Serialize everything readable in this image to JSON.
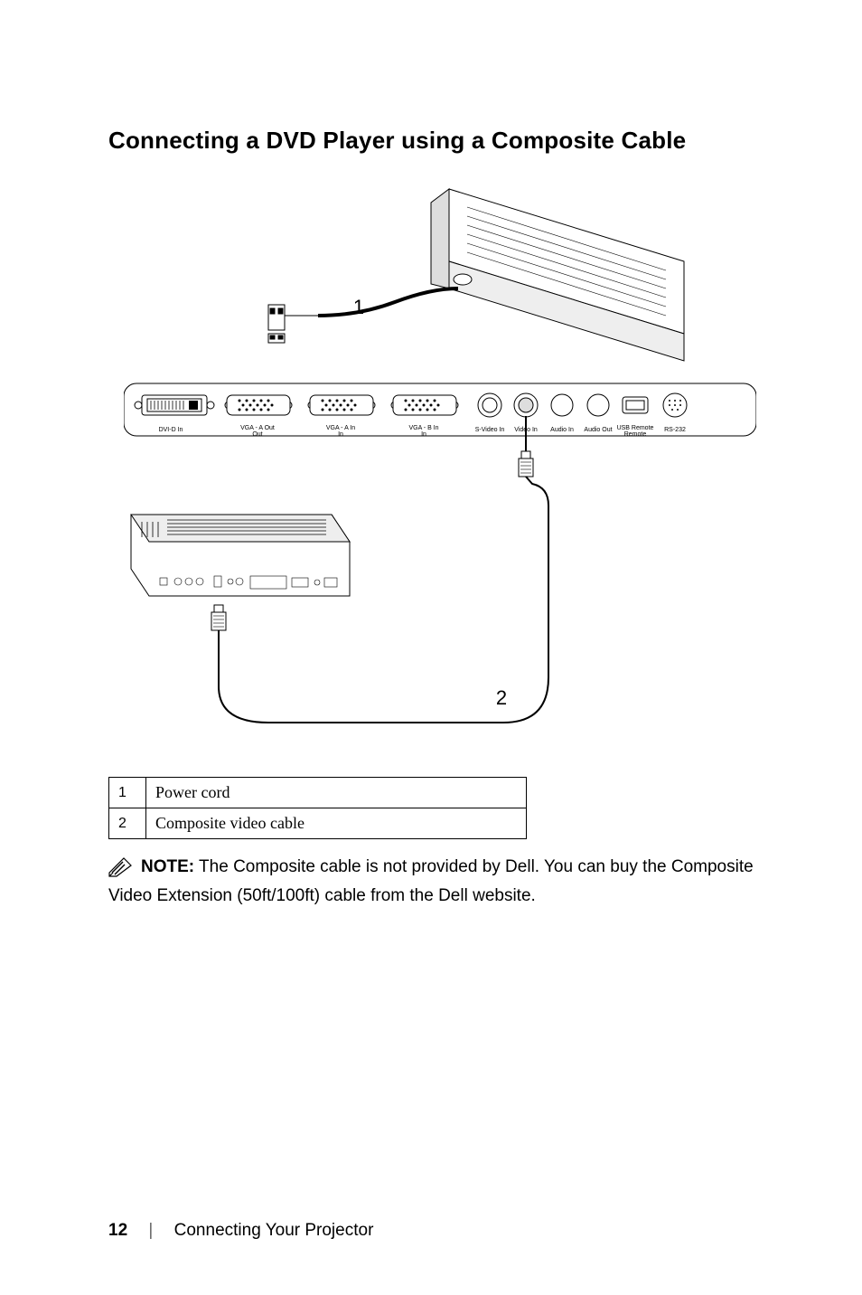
{
  "title": "Connecting a DVD Player using a Composite Cable",
  "diagram": {
    "callouts": [
      "1",
      "2"
    ],
    "ports": [
      "DVI-D In",
      "VGA - A Out",
      "VGA - A In",
      "VGA - B In",
      "S-Video In",
      "Video In",
      "Audio In",
      "Audio Out",
      "USB Remote",
      "RS-232"
    ]
  },
  "legend": [
    {
      "num": "1",
      "text": "Power cord"
    },
    {
      "num": "2",
      "text": "Composite video cable"
    }
  ],
  "note": {
    "label": "NOTE:",
    "text": "The Composite cable is not provided by Dell. You can buy the Composite Video Extension (50ft/100ft) cable from the Dell website."
  },
  "footer": {
    "page": "12",
    "section": "Connecting Your Projector"
  }
}
